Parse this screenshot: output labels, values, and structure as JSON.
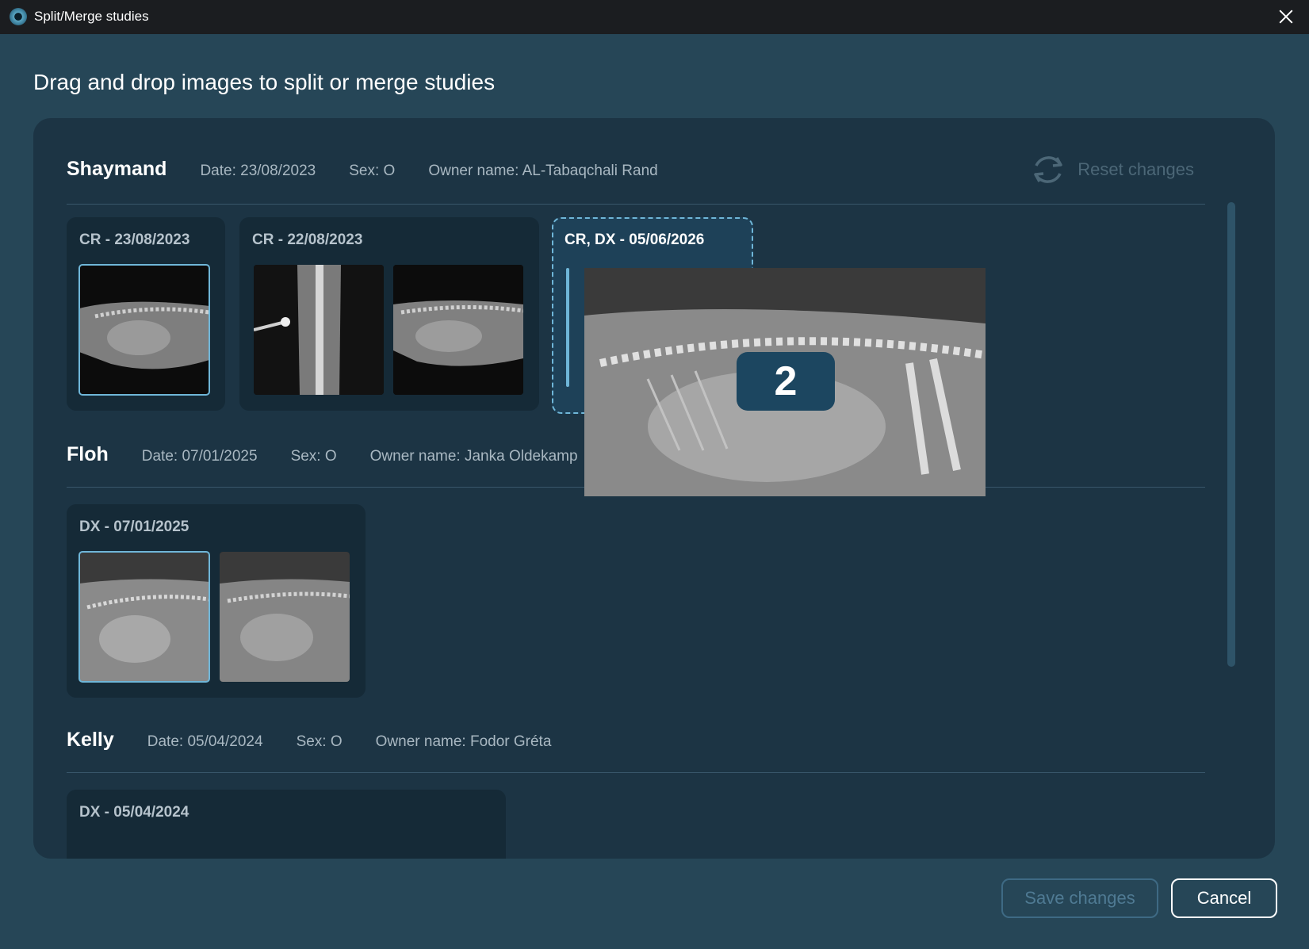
{
  "window": {
    "title": "Split/Merge studies"
  },
  "heading": "Drag and drop images to split or merge studies",
  "reset": {
    "label": "Reset changes"
  },
  "patients": [
    {
      "name": "Shaymand",
      "date": "Date: 23/08/2023",
      "sex": "Sex: O",
      "owner": "Owner name: AL-Tabaqchali Rand",
      "studies": [
        {
          "title": "CR - 23/08/2023",
          "images": 1
        },
        {
          "title": "CR - 22/08/2023",
          "images": 2
        }
      ],
      "drop_target": {
        "title": "CR, DX - 05/06/2026"
      }
    },
    {
      "name": "Floh",
      "date": "Date: 07/01/2025",
      "sex": "Sex: O",
      "owner": "Owner name: Janka Oldekamp",
      "studies": [
        {
          "title": "DX - 07/01/2025",
          "images": 2
        }
      ]
    },
    {
      "name": "Kelly",
      "date": "Date: 05/04/2024",
      "sex": "Sex: O",
      "owner": "Owner name: Fodor Gréta",
      "studies": [
        {
          "title": "DX - 05/04/2024",
          "images": 0
        }
      ]
    }
  ],
  "drag": {
    "count": "2"
  },
  "buttons": {
    "save": "Save changes",
    "cancel": "Cancel"
  },
  "colors": {
    "background": "#264657",
    "panel": "#1c3444",
    "accent": "#6fb6d8"
  }
}
